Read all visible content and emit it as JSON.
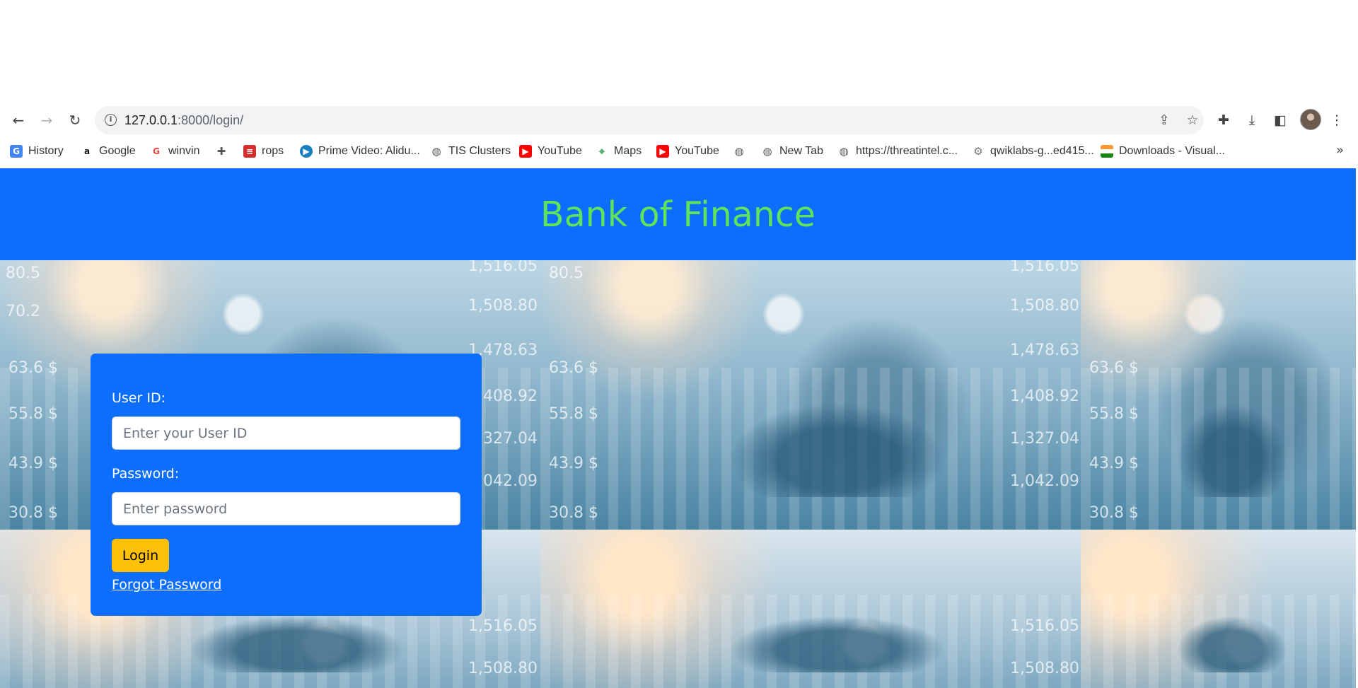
{
  "browser": {
    "url_host": "127.0.0.1",
    "url_path": ":8000/login/",
    "bookmarks": [
      {
        "label": "History",
        "icon": "history-g-icon",
        "color": "#4285f4"
      },
      {
        "label": "Google",
        "icon": "amazon-icon",
        "color": "#111111"
      },
      {
        "label": "winvin",
        "icon": "google-icon",
        "color": "#ea4335"
      },
      {
        "label": "",
        "icon": "extension-icon",
        "color": "#555555"
      },
      {
        "label": "rops",
        "icon": "rops-icon",
        "color": "#d32f2f"
      },
      {
        "label": "Prime Video: Alidu...",
        "icon": "prime-video-icon",
        "color": "#1a7fc1"
      },
      {
        "label": "TIS Clusters",
        "icon": "globe-icon",
        "color": "#555555"
      },
      {
        "label": "YouTube",
        "icon": "youtube-icon",
        "color": "#ff0000"
      },
      {
        "label": "Maps",
        "icon": "maps-icon",
        "color": "#34a853"
      },
      {
        "label": "YouTube",
        "icon": "youtube-icon",
        "color": "#ff0000"
      },
      {
        "label": "",
        "icon": "globe-icon",
        "color": "#555555"
      },
      {
        "label": "New Tab",
        "icon": "globe-icon",
        "color": "#555555"
      },
      {
        "label": "https://threatintel.c...",
        "icon": "globe-icon",
        "color": "#555555"
      },
      {
        "label": "qwiklabs-g...ed415...",
        "icon": "gear-icon",
        "color": "#777777"
      },
      {
        "label": "Downloads - Visual...",
        "icon": "india-flag-icon",
        "color": "#ff9933"
      }
    ]
  },
  "page": {
    "header_title": "Bank of Finance",
    "header_color": "#0d6efd",
    "title_color": "#5ee35a",
    "background_numbers": [
      "80.5",
      "70.2",
      "63.6 $",
      "55.8 $",
      "43.9 $",
      "30.8 $",
      "1,516.05",
      "1,508.80",
      "1,478.63",
      "1,408.92",
      "1,327.04",
      "1,042.09"
    ]
  },
  "login": {
    "userid_label": "User ID:",
    "userid_placeholder": "Enter your User ID",
    "password_label": "Password:",
    "password_placeholder": "Enter password",
    "login_button": "Login",
    "forgot_link": "Forgot Password",
    "button_color": "#ffc107"
  }
}
